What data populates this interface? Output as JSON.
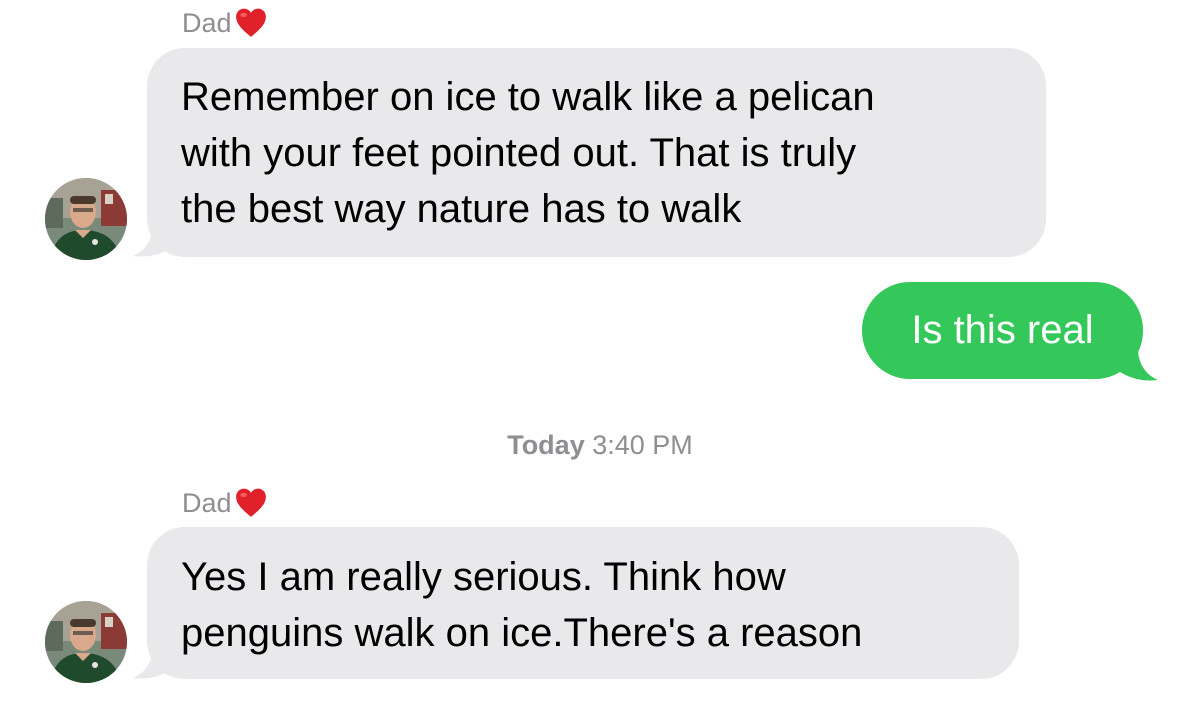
{
  "conversation": {
    "contact_name": "Dad",
    "contact_badge_icon": "red-heart-icon",
    "colors": {
      "incoming_bubble": "#e9e9eb",
      "outgoing_bubble": "#34c759",
      "meta_text": "#8e8e93",
      "heart": "#e0202a"
    },
    "messages": [
      {
        "direction": "incoming",
        "sender": "Dad",
        "text": "Remember on ice to walk like a pelican\nwith your feet pointed out. That is truly\nthe best way nature has to walk"
      },
      {
        "direction": "outgoing",
        "text": "Is this real"
      },
      {
        "direction": "incoming",
        "sender": "Dad",
        "text": "Yes I am really serious. Think how\npenguins walk on ice.There's a reason"
      }
    ],
    "timestamp": {
      "day": "Today",
      "time": "3:40 PM"
    }
  }
}
